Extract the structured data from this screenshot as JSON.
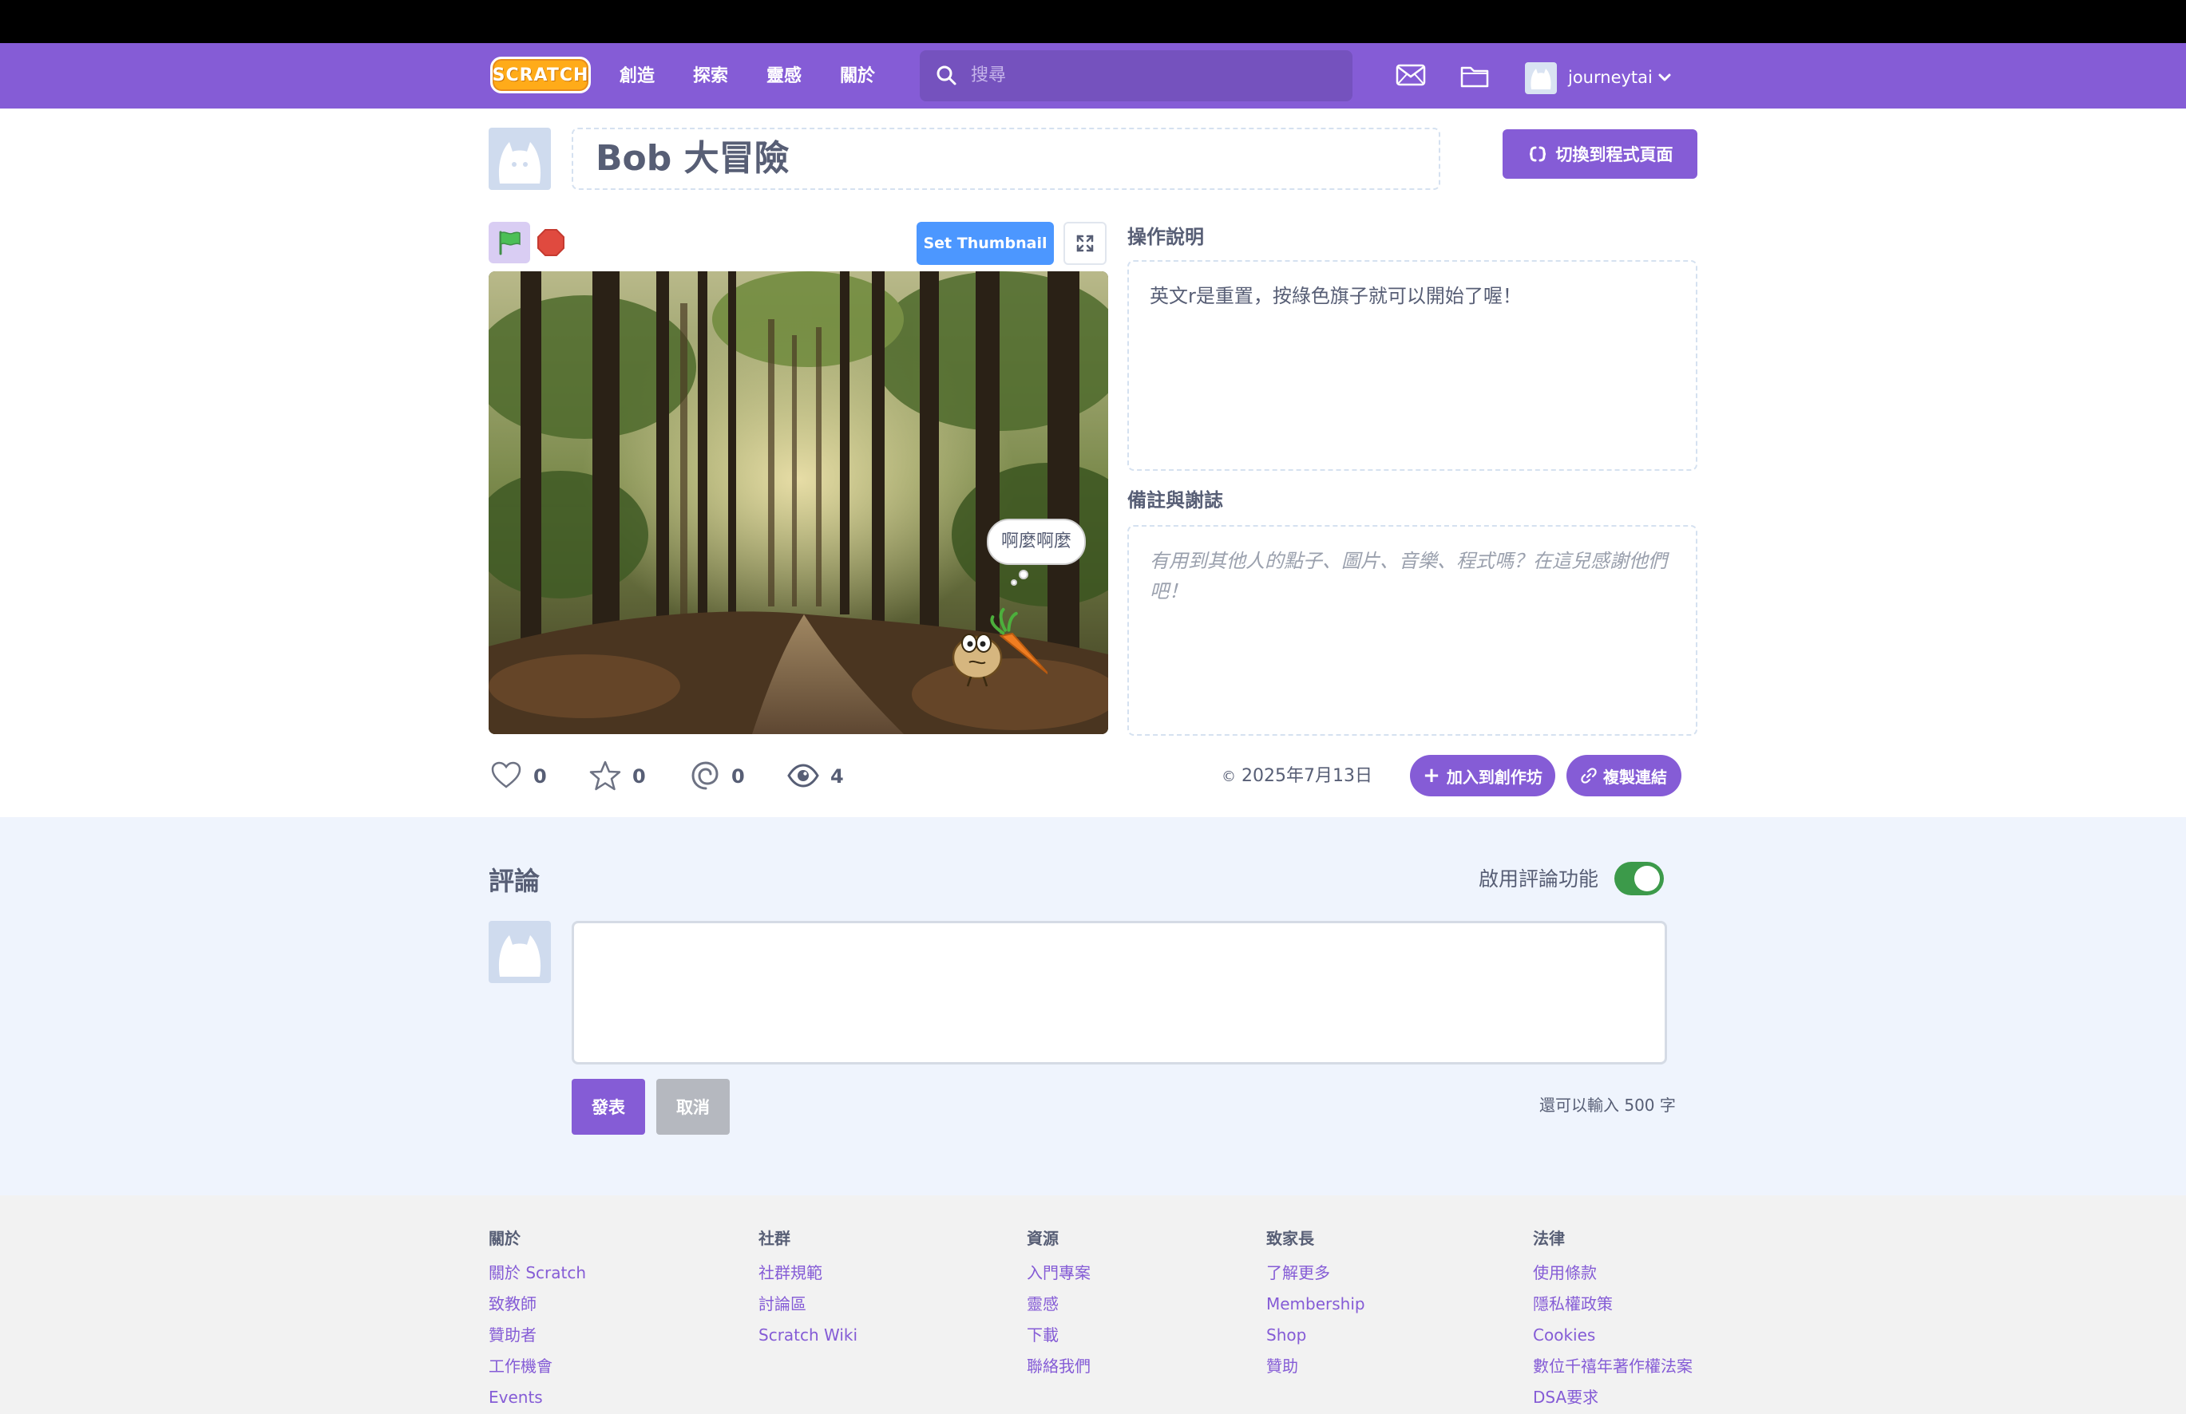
{
  "nav": {
    "logo_text": "SCRATCH",
    "links": [
      "創造",
      "探索",
      "靈感",
      "關於"
    ],
    "search_placeholder": "搜尋",
    "username": "journeytai"
  },
  "project": {
    "title": "Bob 大冒險",
    "see_inside_label": "切換到程式頁面",
    "set_thumbnail_label": "Set Thumbnail",
    "speech_bubble": "啊麼啊麼",
    "instructions_label": "操作說明",
    "instructions_text": "英文r是重置，按綠色旗子就可以開始了喔！",
    "notes_label": "備註與謝誌",
    "notes_placeholder": "有用到其他人的點子、圖片、音樂、程式嗎？在這兒感謝他們吧！",
    "stats": {
      "loves": "0",
      "favorites": "0",
      "remixes": "0",
      "views": "4"
    },
    "date": "2025年7月13日",
    "add_to_studio_label": "加入到創作坊",
    "copy_link_label": "複製連結"
  },
  "comments": {
    "title": "評論",
    "toggle_label": "啟用評論功能",
    "toggle_on": true,
    "post_label": "發表",
    "cancel_label": "取消",
    "char_count": "還可以輸入 500 字"
  },
  "footer": {
    "columns": [
      {
        "heading": "關於",
        "links": [
          "關於 Scratch",
          "致教師",
          "贊助者",
          "工作機會",
          "Events"
        ]
      },
      {
        "heading": "社群",
        "links": [
          "社群規範",
          "討論區",
          "Scratch Wiki"
        ]
      },
      {
        "heading": "資源",
        "links": [
          "入門專案",
          "靈感",
          "下載",
          "聯絡我們"
        ]
      },
      {
        "heading": "致家長",
        "links": [
          "了解更多",
          "Membership",
          "Shop",
          "贊助"
        ]
      },
      {
        "heading": "法律",
        "links": [
          "使用條款",
          "隱私權政策",
          "Cookies",
          "數位千禧年著作權法案",
          "DSA要求"
        ]
      }
    ]
  },
  "colors": {
    "brand": "#855cd6",
    "accent_blue": "#4c97ff",
    "toggle_green": "#3c9a4a",
    "stop_red": "#e04a3f",
    "flag_green": "#4cbf56"
  },
  "icons": {
    "search": "search-icon",
    "messages": "mail-icon",
    "my_stuff": "folder-icon",
    "love": "heart-icon",
    "favorite": "star-icon",
    "remix": "remix-icon",
    "views": "eye-icon"
  }
}
